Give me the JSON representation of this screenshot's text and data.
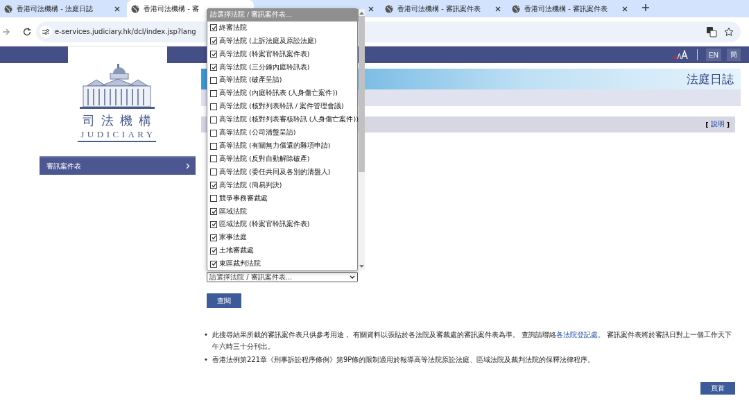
{
  "browser": {
    "tabs": [
      {
        "title": "香港司法機構 - 法庭日誌",
        "selected": false
      },
      {
        "title": "香港司法機構 - 審",
        "selected": true
      },
      {
        "selected": false
      },
      {
        "title": "香港司法機構 - 審訊案件表",
        "selected": false
      },
      {
        "title": "香港司法機構 - 審訊案件表",
        "selected": false
      }
    ],
    "url": "e-services.judiciary.hk/dcl/index.jsp?lang"
  },
  "header": {
    "language_buttons": [
      "EN",
      "簡"
    ]
  },
  "logo": {
    "chinese": "司法機構",
    "english": "JUDICIARY"
  },
  "sidebar": {
    "items": [
      {
        "label": "審訊案件表"
      }
    ]
  },
  "banner": {
    "title": "法庭日誌"
  },
  "help": {
    "open": "[",
    "link": "說明",
    "close": "]"
  },
  "dropdown": {
    "highlighted": {
      "label": "請選擇法院 / 審訊案件表...",
      "selected": true
    },
    "value": "請選擇法院 / 審訊案件表...",
    "options": [
      {
        "label": "終審法院",
        "checked": true
      },
      {
        "label": "高等法院 (上訴法庭及原訟法庭)",
        "checked": true
      },
      {
        "label": "高等法院 (聆案官聆訊案件表)",
        "checked": true
      },
      {
        "label": "高等法院 (三分鐘內庭聆訊表)",
        "checked": true
      },
      {
        "label": "高等法院 (破產呈請)",
        "checked": false
      },
      {
        "label": "高等法院 (內庭聆訊表 (人身傷亡案件))",
        "checked": false
      },
      {
        "label": "高等法院 (核對列表聆訊 / 案件管理會議)",
        "checked": false
      },
      {
        "label": "高等法院 (核對列表審核聆訊 (人身傷亡案件))",
        "checked": false
      },
      {
        "label": "高等法院 (公司清盤呈請)",
        "checked": false
      },
      {
        "label": "高等法院 (有關無力償還的雜項申請)",
        "checked": false
      },
      {
        "label": "高等法院 (反對自動解除破產)",
        "checked": false
      },
      {
        "label": "高等法院 (委任共同及各別的清盤人)",
        "checked": false
      },
      {
        "label": "高等法院 (簡易判決)",
        "checked": true
      },
      {
        "label": "競爭事務審裁處",
        "checked": false
      },
      {
        "label": "區域法院",
        "checked": true
      },
      {
        "label": "區域法院 (聆案官聆訊案件表)",
        "checked": true
      },
      {
        "label": "家事法庭",
        "checked": true
      },
      {
        "label": "土地審裁處",
        "checked": true
      },
      {
        "label": "東區裁判法院",
        "checked": true
      }
    ]
  },
  "search_button": "查閱",
  "notes": [
    {
      "marker": "•",
      "before": "此搜尋結果所載的審訊案件表只供參考用途， 有關資料以張貼於各法院及審裁處的審訊案件表為準。 查詢請聯絡",
      "link": "各法院登記處",
      "after": "。 審訊案件表將於審訊日對上一個工作天下午六時三十分刊出。"
    },
    {
      "marker": "•",
      "before": "香港法例第221章《刑事訴訟程序條例》第9P條的限制適用於報導高等法院原訟法庭、區域法院及裁判法院的保釋法律程序。"
    }
  ],
  "top_button": "頁首"
}
